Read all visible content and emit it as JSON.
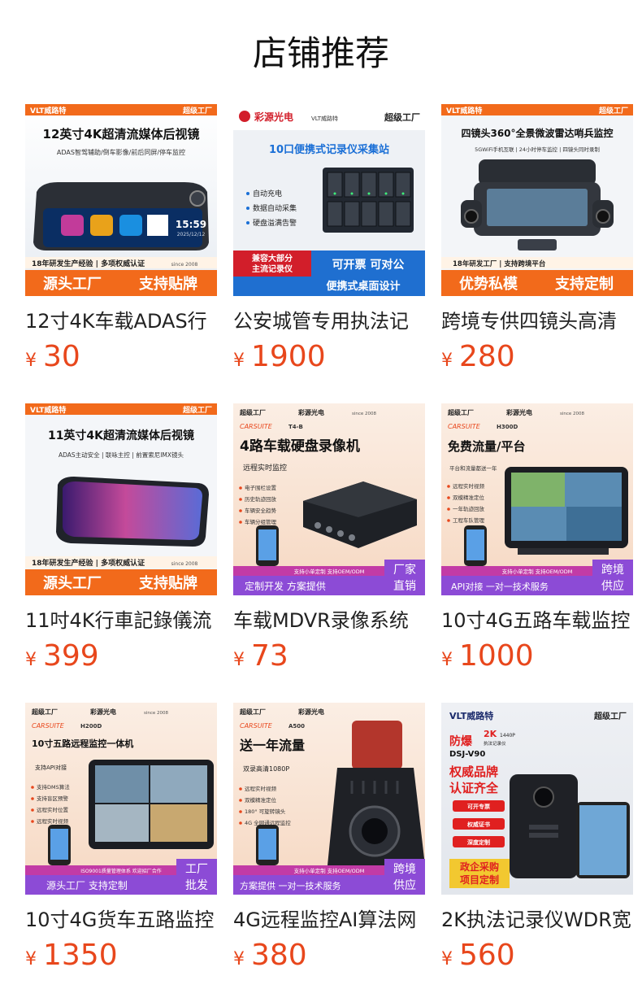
{
  "page": {
    "title": "店铺推荐"
  },
  "colors": {
    "price": "#e8471c",
    "badge_orange": "#f26a1b",
    "badge_purple": "#8c4bd6"
  },
  "products": [
    {
      "name": "12寸4K车载ADAS行",
      "currency": "¥",
      "price": "30",
      "image": {
        "top_brand": "VLT威路特",
        "top_right": "超级工厂",
        "headline": "12英寸4K超清流媒体后视镜",
        "sub": "ADAS智驾辅助/倒车影像/前后同屏/停车监控",
        "screen_time": "15:59",
        "screen_date": "2025/12/12",
        "ribbon": "18年研发生产经验 | 多项权威认证",
        "since": "since 2008",
        "footer_left": "源头工厂",
        "footer_right": "支持贴牌"
      }
    },
    {
      "name": "公安城管专用执法记",
      "currency": "¥",
      "price": "1900",
      "image": {
        "brand": "彩源光电",
        "brand2": "VLT威路特",
        "top_right": "超级工厂",
        "headline": "10口便携式记录仪采集站",
        "features": [
          "自动充电",
          "数据自动采集",
          "硬盘溢满告警"
        ],
        "red_tag": [
          "兼容大部分",
          "主流记录仪"
        ],
        "blue_line1": "可开票  可对公",
        "blue_line2": "便携式桌面设计"
      }
    },
    {
      "name": "跨境专供四镜头高清",
      "currency": "¥",
      "price": "280",
      "image": {
        "top_brand": "VLT威路特",
        "top_right": "超级工厂",
        "headline": "四镜头360°全景微波雷达哨兵监控",
        "sub": "5GWiFi手机互联 | 24小时停车监控 | 四镜头同时录制",
        "ribbon": "18年研发工厂 | 支持跨境平台",
        "footer_left": "优势私模",
        "footer_right": "支持定制"
      }
    },
    {
      "name": "11吋4K行車記錄儀流",
      "currency": "¥",
      "price": "399",
      "image": {
        "top_brand": "VLT威路特",
        "top_right": "超级工厂",
        "headline": "11英寸4K超清流媒体后视镜",
        "sub": "ADAS主动安全 | 联咏主控 | 前置索尼IMX镜头",
        "ribbon": "18年研发生产经验 | 多项权威认证",
        "since": "since 2008",
        "footer_left": "源头工厂",
        "footer_right": "支持贴牌"
      }
    },
    {
      "name": "车载MDVR录像系统",
      "currency": "¥",
      "price": "73",
      "image": {
        "top_left": "超级工厂",
        "brand": "彩源光电",
        "since": "since 2008",
        "series": "CARSUITE",
        "model": "T4-B",
        "headline": "4路车载硬盘录像机",
        "sub": "远程实时监控",
        "features": [
          "电子围栏设置",
          "历史轨迹回放",
          "车辆安全趋势",
          "车辆分组管理"
        ],
        "strip": "支持小单定制  支持OEM/ODM",
        "footer_left": "定制开发   方案提供",
        "badge": [
          "厂家",
          "直销"
        ]
      }
    },
    {
      "name": "10寸4G五路车载监控",
      "currency": "¥",
      "price": "1000",
      "image": {
        "top_left": "超级工厂",
        "brand": "彩源光电",
        "since": "since 2008",
        "series": "CARSUITE",
        "model": "H300D",
        "headline": "免费流量/平台",
        "sub": "平台和流量都送一年",
        "features": [
          "远程实时视频",
          "双模精准定位",
          "一年轨迹回放",
          "工程车队管理"
        ],
        "strip": "支持小单定制  支持OEM/ODM",
        "footer_left": "API对接 一对一技术服务",
        "badge": [
          "跨境",
          "供应"
        ]
      }
    },
    {
      "name": "10寸4G货车五路监控",
      "currency": "¥",
      "price": "1350",
      "image": {
        "top_left": "超级工厂",
        "brand": "彩源光电",
        "since": "since 2008",
        "series": "CARSUITE",
        "model": "H200D",
        "headline": "10寸五路远程监控一体机",
        "sub": "支持API对接",
        "features": [
          "支持DMS算法",
          "支持盲区预警",
          "远程实时位置",
          "远程实时视频"
        ],
        "strip": "ISO9001质量管理体系  欢迎招厂合作",
        "footer_left": "源头工厂  支持定制",
        "badge": [
          "工厂",
          "批发"
        ]
      }
    },
    {
      "name": "4G远程监控AI算法网",
      "currency": "¥",
      "price": "380",
      "image": {
        "top_left": "超级工厂",
        "brand": "彩源光电",
        "since": "since 2008",
        "series": "CARSUITE",
        "model": "A500",
        "headline": "送一年流量",
        "sub": "双录高清1080P",
        "features": [
          "远程实时视频",
          "双模精准定位",
          "180° 可旋转镜头",
          "4G 全网通远程监控"
        ],
        "strip": "支持小单定制  支持OEM/ODM",
        "footer_left": "方案提供 一对一技术服务",
        "badge": [
          "跨境",
          "供应"
        ]
      }
    },
    {
      "name": "2K执法记录仪WDR宽",
      "currency": "¥",
      "price": "560",
      "image": {
        "top_brand": "VLT威路特",
        "top_right": "超级工厂",
        "red_title": "防爆",
        "res": "2K",
        "res2": "1440P",
        "cat": "执法记录仪",
        "model": "DSJ-V90",
        "headline": [
          "权威品牌",
          "认证齐全"
        ],
        "pills": [
          "可开专票",
          "权威证书",
          "深度定制"
        ],
        "footer": [
          "政企采购",
          "项目定制"
        ]
      }
    }
  ]
}
